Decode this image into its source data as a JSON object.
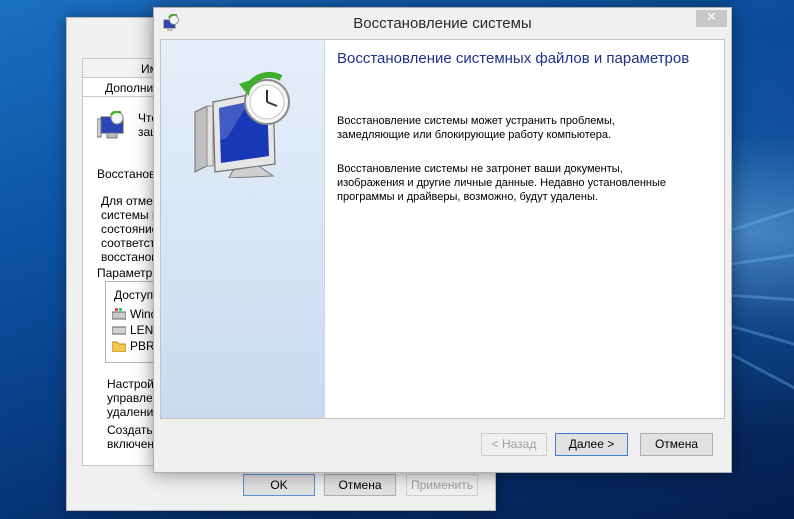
{
  "background_window": {
    "tabs_row1": [
      "Им"
    ],
    "tabs_row2": [
      "Дополнит"
    ],
    "protection_text_line1": "Что",
    "protection_text_line2": "защ",
    "restore_heading": "Восстанов",
    "restore_desc": [
      "Для отмен",
      "системы в",
      "состояние",
      "соответст",
      "восстанов"
    ],
    "protection_settings_label": "Параметры",
    "drives_header": "Доступн",
    "drives": [
      {
        "label": "Windo",
        "icon": "windows-drive-icon"
      },
      {
        "label": "LENO",
        "icon": "drive-icon"
      },
      {
        "label": "PBR_",
        "icon": "folder-icon"
      }
    ],
    "configure_text": [
      "Настройк",
      "управлен",
      "удаление"
    ],
    "create_text": [
      "Создать т",
      "включен"
    ],
    "buttons": {
      "ok": "OK",
      "cancel": "Отмена",
      "apply": "Применить"
    }
  },
  "wizard": {
    "title": "Восстановление системы",
    "close_label": "✕",
    "heading": "Восстановление системных файлов и параметров",
    "para1": [
      "Восстановление системы может устранить проблемы,",
      "замедляющие или блокирующие работу компьютера."
    ],
    "para2": [
      "Восстановление системы не затронет ваши документы,",
      "изображения и другие личные данные. Недавно установленные",
      "программы и драйверы, возможно, будут удалены."
    ],
    "buttons": {
      "back": "< Назад",
      "next": "Далее >",
      "cancel": "Отмена"
    }
  },
  "colors": {
    "heading": "#1e3287",
    "accent": "#3c7fd3",
    "monitor_screen": "#1838b8",
    "restore_arrow": "#3fae2a"
  }
}
